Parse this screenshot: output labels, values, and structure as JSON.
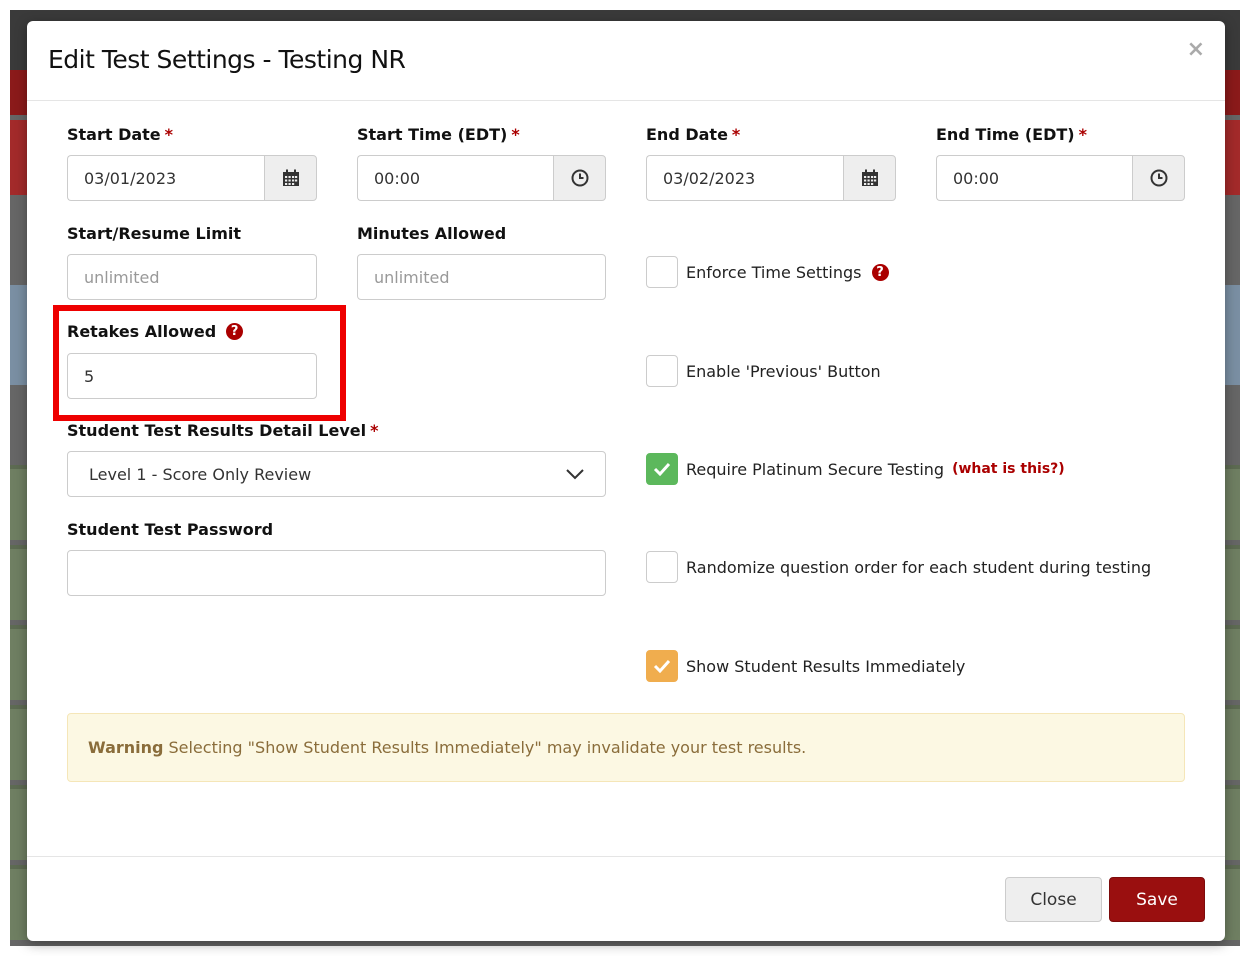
{
  "modal": {
    "title": "Edit Test Settings - Testing NR",
    "close_glyph": "×"
  },
  "fields": {
    "start_date": {
      "label": "Start Date",
      "value": "03/01/2023"
    },
    "start_time": {
      "label": "Start Time (EDT)",
      "value": "00:00"
    },
    "end_date": {
      "label": "End Date",
      "value": "03/02/2023"
    },
    "end_time": {
      "label": "End Time (EDT)",
      "value": "00:00"
    },
    "start_resume_limit": {
      "label": "Start/Resume Limit",
      "placeholder": "unlimited"
    },
    "minutes_allowed": {
      "label": "Minutes Allowed",
      "placeholder": "unlimited"
    },
    "retakes_allowed": {
      "label": "Retakes Allowed",
      "value": "5"
    },
    "detail_level": {
      "label": "Student Test Results Detail Level",
      "value": "Level 1 - Score Only Review"
    },
    "password": {
      "label": "Student Test Password",
      "value": ""
    }
  },
  "required_marker": "*",
  "help_glyph": "?",
  "checkboxes": {
    "enforce_time": {
      "label": "Enforce Time Settings",
      "checked": false
    },
    "enable_previous": {
      "label": "Enable 'Previous' Button",
      "checked": false
    },
    "platinum_secure": {
      "label": "Require Platinum Secure Testing",
      "link": "(what is this?)",
      "checked": true,
      "color": "#5cb85c"
    },
    "randomize": {
      "label": "Randomize question order for each student during testing",
      "checked": false
    },
    "show_results": {
      "label": "Show Student Results Immediately",
      "checked": true,
      "color": "#f0ad4e"
    }
  },
  "warning": {
    "strong": "Warning",
    "text": "Selecting \"Show Student Results Immediately\" may invalidate your test results."
  },
  "footer": {
    "close_label": "Close",
    "save_label": "Save"
  },
  "colors": {
    "accent_red": "#9a0f0f",
    "required_red": "#aa0000",
    "highlight_red": "#ee0000"
  },
  "icons": [
    "calendar-icon",
    "clock-icon",
    "help-icon",
    "chevron-down-icon",
    "check-icon",
    "close-icon"
  ]
}
